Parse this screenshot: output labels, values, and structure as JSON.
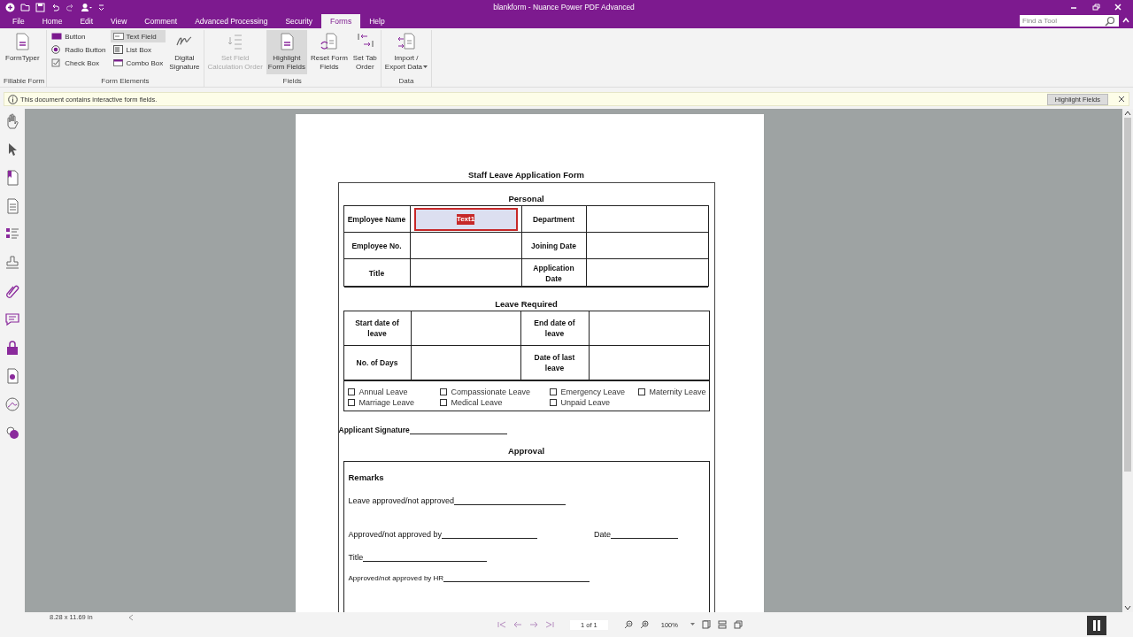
{
  "window": {
    "title": "blankform - Nuance Power PDF Advanced"
  },
  "menu_tabs": [
    {
      "label": "File",
      "selected": false
    },
    {
      "label": "Home",
      "selected": false
    },
    {
      "label": "Edit",
      "selected": false
    },
    {
      "label": "View",
      "selected": false
    },
    {
      "label": "Comment",
      "selected": false
    },
    {
      "label": "Advanced Processing",
      "selected": false
    },
    {
      "label": "Security",
      "selected": false
    },
    {
      "label": "Forms",
      "selected": true
    },
    {
      "label": "Help",
      "selected": false
    }
  ],
  "search": {
    "placeholder": "Find a Tool"
  },
  "ribbon": [
    {
      "label": "Fillable Form",
      "items": [
        {
          "kind": "large",
          "lines": [
            "FormTyper"
          ],
          "selected": false,
          "disabled": false
        }
      ]
    },
    {
      "label": "Form Elements",
      "items": [
        {
          "kind": "small",
          "lines": [
            "Button"
          ],
          "selected": false,
          "disabled": false
        },
        {
          "kind": "small",
          "lines": [
            "Radio Button"
          ],
          "selected": false,
          "disabled": false
        },
        {
          "kind": "small",
          "lines": [
            "Check Box"
          ],
          "selected": false,
          "disabled": false
        },
        {
          "kind": "small",
          "lines": [
            "Text Field"
          ],
          "selected": true,
          "disabled": false
        },
        {
          "kind": "small",
          "lines": [
            "List Box"
          ],
          "selected": false,
          "disabled": false
        },
        {
          "kind": "small",
          "lines": [
            "Combo Box"
          ],
          "selected": false,
          "disabled": false
        },
        {
          "kind": "large",
          "lines": [
            "Digital",
            "Signature"
          ],
          "selected": false,
          "disabled": false
        }
      ]
    },
    {
      "label": "Fields",
      "items": [
        {
          "kind": "large",
          "lines": [
            "Set Field",
            "Calculation Order"
          ],
          "selected": false,
          "disabled": true
        },
        {
          "kind": "large",
          "lines": [
            "Highlight",
            "Form Fields"
          ],
          "selected": true,
          "disabled": false
        },
        {
          "kind": "large",
          "lines": [
            "Reset Form",
            "Fields"
          ],
          "selected": false,
          "disabled": false
        },
        {
          "kind": "large",
          "lines": [
            "Set Tab",
            "Order"
          ],
          "selected": false,
          "disabled": false
        }
      ]
    },
    {
      "label": "Data",
      "items": [
        {
          "kind": "large",
          "lines": [
            "Import /",
            "Export Data"
          ],
          "selected": false,
          "disabled": false,
          "dropdown": true
        }
      ]
    }
  ],
  "info_bar": {
    "message": "This document contains interactive form fields.",
    "button": "Highlight Fields"
  },
  "document": {
    "title": "Staff Leave Application Form",
    "personal": {
      "heading": "Personal",
      "rows": [
        [
          {
            "text": "Employee Name"
          },
          {
            "field": "Text1",
            "selected": true
          },
          {
            "text": "Department"
          },
          {}
        ],
        [
          {
            "text": "Employee No."
          },
          {},
          {
            "text": "Joining Date"
          },
          {}
        ],
        [
          {
            "text": "Title"
          },
          {},
          {
            "text": "Application Date"
          },
          {}
        ]
      ]
    },
    "leave": {
      "heading": "Leave Required",
      "rows": [
        [
          {
            "text": "Start date of leave"
          },
          {},
          {
            "text": "End date of leave"
          },
          {}
        ],
        [
          {
            "text": "No. of Days"
          },
          {},
          {
            "text": "Date of last leave"
          },
          {}
        ]
      ],
      "checkbox_rows": [
        [
          {
            "label": "Annual Leave",
            "checked": false
          },
          {
            "label": "Compassionate Leave",
            "checked": false
          },
          {
            "label": "Emergency Leave",
            "checked": false
          },
          {
            "label": "Maternity Leave",
            "checked": false
          }
        ],
        [
          {
            "label": "Marriage Leave",
            "checked": false
          },
          {
            "label": "Medical Leave",
            "checked": false
          },
          {
            "label": "Unpaid Leave",
            "checked": false
          }
        ]
      ]
    },
    "signature": "Applicant Signature",
    "approval": {
      "heading": "Approval",
      "remarks": "Remarks",
      "lines": [
        [
          {
            "label": "Leave approved/not approved"
          }
        ],
        [
          {
            "label": "Approved/not approved by"
          },
          {
            "label": "Date"
          }
        ],
        [
          {
            "label": "Title"
          }
        ],
        [
          {
            "label": "Approved/not approved by HR",
            "small": true
          }
        ]
      ]
    }
  },
  "status_bar": {
    "page_size": "8.28 x 11.69 in",
    "page": "1 of 1",
    "zoom": "100%"
  }
}
